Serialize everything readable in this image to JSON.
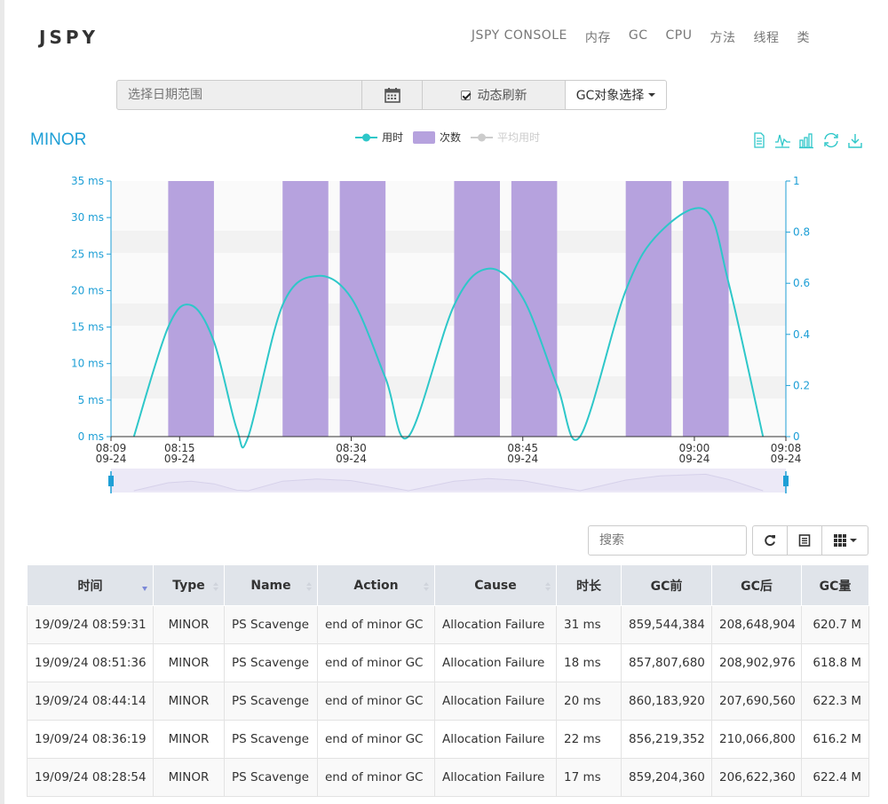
{
  "brand": "JSPY",
  "nav": [
    "JSPY CONSOLE",
    "内存",
    "GC",
    "CPU",
    "方法",
    "线程",
    "类"
  ],
  "toolbar": {
    "date_placeholder": "选择日期范围",
    "refresh_label": "动态刷新",
    "gc_select_label": "GC对象选择"
  },
  "chart_data": {
    "type": "bar",
    "title": "MINOR",
    "legend": [
      "用时",
      "次数",
      "平均用时"
    ],
    "colors": {
      "duration": "#2ec7c9",
      "count": "#b6a2de",
      "avg": "#cccccc",
      "title": "#1e9fd6",
      "axis": "#1e9fd6"
    },
    "y_left": {
      "ticks": [
        "0 ms",
        "5 ms",
        "10 ms",
        "15 ms",
        "20 ms",
        "25 ms",
        "30 ms",
        "35 ms"
      ],
      "ylim": [
        0,
        35
      ]
    },
    "y_right": {
      "ticks": [
        "0",
        "0.2",
        "0.4",
        "0.6",
        "0.8",
        "1"
      ],
      "ylim": [
        0,
        1
      ]
    },
    "x_ticks": [
      {
        "t": 0,
        "time": "08:09",
        "date": "09-24"
      },
      {
        "t": 6,
        "time": "08:15",
        "date": "09-24"
      },
      {
        "t": 21,
        "time": "08:30",
        "date": "09-24"
      },
      {
        "t": 36,
        "time": "08:45",
        "date": "09-24"
      },
      {
        "t": 51,
        "time": "09:00",
        "date": "09-24"
      },
      {
        "t": 59,
        "time": "09:08",
        "date": "09-24"
      }
    ],
    "bars": [
      {
        "start": 5,
        "end": 9,
        "value": 1
      },
      {
        "start": 15,
        "end": 19,
        "value": 1
      },
      {
        "start": 20,
        "end": 24,
        "value": 1
      },
      {
        "start": 30,
        "end": 34,
        "value": 1
      },
      {
        "start": 35,
        "end": 39,
        "value": 1
      },
      {
        "start": 45,
        "end": 49,
        "value": 1
      },
      {
        "start": 50,
        "end": 54,
        "value": 1
      }
    ],
    "duration_points": [
      [
        2,
        0
      ],
      [
        5,
        15
      ],
      [
        7,
        18
      ],
      [
        9,
        13
      ],
      [
        11,
        1
      ],
      [
        12,
        0
      ],
      [
        15,
        18
      ],
      [
        18,
        22
      ],
      [
        21,
        19
      ],
      [
        24,
        8
      ],
      [
        26,
        0
      ],
      [
        30,
        18
      ],
      [
        33,
        23
      ],
      [
        36,
        19
      ],
      [
        39,
        7
      ],
      [
        41,
        0
      ],
      [
        45,
        20
      ],
      [
        48,
        28
      ],
      [
        52,
        31
      ],
      [
        54,
        21
      ],
      [
        57,
        0
      ]
    ],
    "toolbox_icons": [
      "data-view-icon",
      "line-chart-icon",
      "bar-chart-icon",
      "restore-icon",
      "download-icon"
    ]
  },
  "table": {
    "search_placeholder": "搜索",
    "columns": [
      "时间",
      "Type",
      "Name",
      "Action",
      "Cause",
      "时长",
      "GC前",
      "GC后",
      "GC量"
    ],
    "rows": [
      [
        "19/09/24 08:59:31",
        "MINOR",
        "PS Scavenge",
        "end of minor GC",
        "Allocation Failure",
        "31 ms",
        "859,544,384",
        "208,648,904",
        "620.7 M"
      ],
      [
        "19/09/24 08:51:36",
        "MINOR",
        "PS Scavenge",
        "end of minor GC",
        "Allocation Failure",
        "18 ms",
        "857,807,680",
        "208,902,976",
        "618.8 M"
      ],
      [
        "19/09/24 08:44:14",
        "MINOR",
        "PS Scavenge",
        "end of minor GC",
        "Allocation Failure",
        "20 ms",
        "860,183,920",
        "207,690,560",
        "622.3 M"
      ],
      [
        "19/09/24 08:36:19",
        "MINOR",
        "PS Scavenge",
        "end of minor GC",
        "Allocation Failure",
        "22 ms",
        "856,219,352",
        "210,066,800",
        "616.2 M"
      ],
      [
        "19/09/24 08:28:54",
        "MINOR",
        "PS Scavenge",
        "end of minor GC",
        "Allocation Failure",
        "17 ms",
        "859,204,360",
        "206,622,360",
        "622.4 M"
      ]
    ]
  }
}
